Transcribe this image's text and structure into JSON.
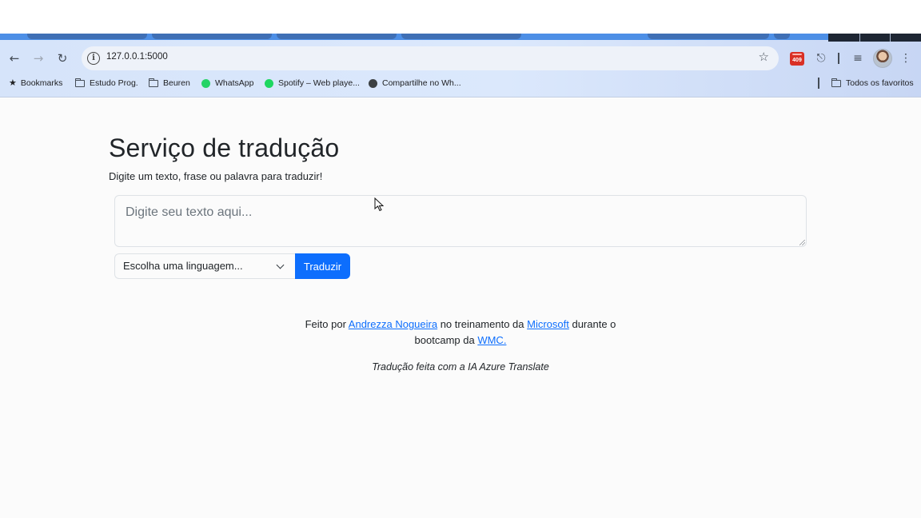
{
  "browser": {
    "url": "127.0.0.1:5000",
    "calendar_badge": "409",
    "bookmarks": [
      {
        "label": "Bookmarks",
        "icon": "star-icon"
      },
      {
        "label": "Estudo Prog.",
        "icon": "folder-icon"
      },
      {
        "label": "Beuren",
        "icon": "folder-icon"
      },
      {
        "label": "WhatsApp",
        "icon": "whatsapp-icon"
      },
      {
        "label": "Spotify – Web playe...",
        "icon": "spotify-icon"
      },
      {
        "label": "Compartilhe no Wh...",
        "icon": "globe-icon"
      }
    ],
    "all_bookmarks": "Todos os favoritos"
  },
  "page": {
    "title": "Serviço de tradução",
    "subtitle": "Digite um texto, frase ou palavra para traduzir!",
    "input_placeholder": "Digite seu texto aqui...",
    "select_value": "Escolha uma linguagem...",
    "button_label": "Traduzir",
    "footer": {
      "pre": "Feito por ",
      "author": "Andrezza Nogueira",
      "mid": " no treinamento da ",
      "company": "Microsoft",
      "post": " durante o bootcamp da ",
      "bootcamp": "WMC.",
      "credit": "Tradução feita com a IA Azure Translate"
    }
  },
  "colors": {
    "primary": "#0d6efd",
    "text": "#212529"
  }
}
